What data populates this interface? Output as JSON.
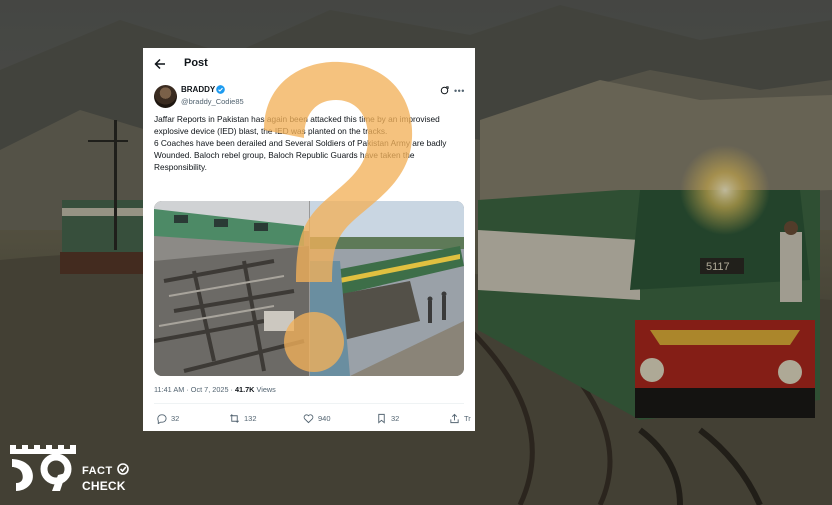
{
  "header": {
    "title": "Post"
  },
  "author": {
    "name": "BRADDY",
    "handle": "@braddy_Codie85"
  },
  "tweet": {
    "paragraphs": [
      "Jaffar Reports in Pakistan has again been attacked this time by an improvised explosive device (IED) blast, the IED was planted on the tracks.",
      "6 Coaches have been derailed and Several Soldiers of Pakistan Army are badly Wounded. Baloch rebel group, Baloch Republic Guards have taken the Responsibility."
    ],
    "time": "11:41 AM · Oct 7, 2025 · ",
    "views": "41.7K",
    "views_label": " Views"
  },
  "actions": {
    "replies": "32",
    "reposts": "132",
    "likes": "940",
    "bookmarks": "32",
    "share_partial": "Tr"
  },
  "logo": {
    "fact": "FACT",
    "check": "CHECK",
    "number": "19"
  },
  "colors": {
    "question_mark": "#f2b15a",
    "verified": "#1d9bf0",
    "train_green": "#3f6a44"
  }
}
